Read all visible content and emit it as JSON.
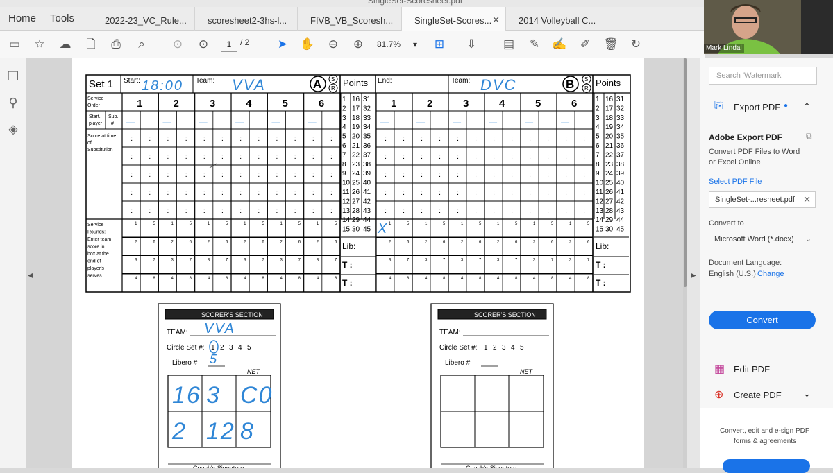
{
  "window": {
    "title": "SingleSet-Scoresheet.pdf"
  },
  "nav": {
    "home": "Home",
    "tools": "Tools"
  },
  "tabs": [
    {
      "label": "2022-23_VC_Rule..."
    },
    {
      "label": "scoresheet2-3hs-l..."
    },
    {
      "label": "FIVB_VB_Scoresh..."
    },
    {
      "label": "SingleSet-Scores..."
    },
    {
      "label": "2014 Volleyball C..."
    }
  ],
  "toolbar": {
    "page_current": "1",
    "page_total": "/ 2",
    "zoom": "81.7%"
  },
  "webcam": {
    "name": "Mark Lindal"
  },
  "right_panel": {
    "search_placeholder": "Search 'Watermark'",
    "export_title": "Export PDF",
    "adobe_export": "Adobe Export PDF",
    "desc1": "Convert PDF Files to Word",
    "desc2": "or Excel Online",
    "select_file": "Select PDF File",
    "file_name": "SingleSet-...resheet.pdf",
    "convert_to": "Convert to",
    "format": "Microsoft Word (*.docx)",
    "doc_language": "Document Language:",
    "language": "English (U.S.)",
    "change": "Change",
    "convert_btn": "Convert",
    "edit_pdf": "Edit PDF",
    "create_pdf": "Create PDF",
    "promo1": "Convert, edit and e-sign PDF",
    "promo2": "forms & agreements"
  },
  "sheet": {
    "set_label": "Set 1",
    "start_label": "Start:",
    "start_time": "18:00",
    "team_label": "Team:",
    "team_a": "VVA",
    "team_a_letter": "A",
    "points": "Points",
    "end_label": "End:",
    "team_b": "DVC",
    "team_b_letter": "B",
    "serve_letter": "S",
    "receive_letter": "R",
    "service_order": "Service Order",
    "start_player": "Start. player",
    "sub_num": "Sub. #",
    "score_at_sub": "Score at time of Substitution",
    "service_rounds": "Service Rounds: Enter team score in box at the end of player's serves",
    "positions": [
      "1",
      "2",
      "3",
      "4",
      "5",
      "6"
    ],
    "lib": "Lib:",
    "t_label": "T  :"
  },
  "scorer_left": {
    "title": "SCORER'S SECTION",
    "team_label": "TEAM:",
    "team": "VVA",
    "circle_set": "Circle Set #:",
    "sets": [
      "1",
      "2",
      "3",
      "4",
      "5"
    ],
    "libero": "Libero #",
    "libero_num": "5",
    "net": "NET",
    "grid": [
      "16",
      "3",
      "C0",
      "2",
      "12",
      "8"
    ],
    "coach_sig": "Coach's Signature"
  },
  "scorer_right": {
    "title": "SCORER'S SECTION",
    "team_label": "TEAM:",
    "circle_set": "Circle Set #:",
    "sets": [
      "1",
      "2",
      "3",
      "4",
      "5"
    ],
    "libero": "Libero #",
    "net": "NET",
    "coach_sig": "Coach's Signature"
  }
}
